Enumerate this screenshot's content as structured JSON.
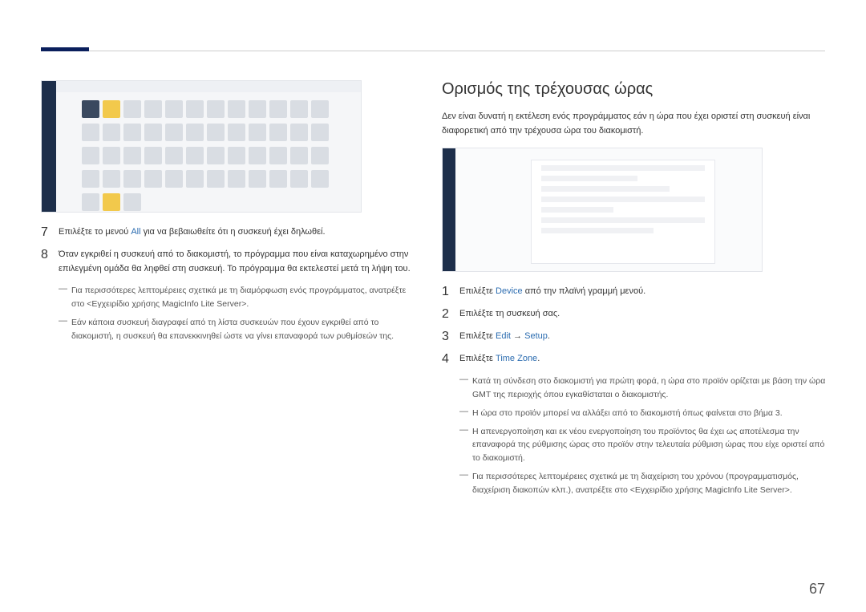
{
  "page_number": "67",
  "left": {
    "step7": {
      "num": "7",
      "prefix": "Επιλέξτε το μενού ",
      "link": "All",
      "suffix": " για να βεβαιωθείτε ότι η συσκευή έχει δηλωθεί."
    },
    "step8": {
      "num": "8",
      "text": "Όταν εγκριθεί η συσκευή από το διακομιστή, το πρόγραμμα που είναι καταχωρημένο στην επιλεγμένη ομάδα θα ληφθεί στη συσκευή. Το πρόγραμμα θα εκτελεστεί μετά τη λήψη του."
    },
    "note1": "Για περισσότερες λεπτομέρειες σχετικά με τη διαμόρφωση ενός προγράμματος, ανατρέξτε στο <Εγχειρίδιο χρήσης MagicInfo Lite Server>.",
    "note2": "Εάν κάποια συσκευή διαγραφεί από τη λίστα συσκευών που έχουν εγκριθεί από το διακομιστή, η συσκευή θα επανεκκινηθεί ώστε να γίνει επαναφορά των ρυθμίσεών της."
  },
  "right": {
    "title": "Ορισμός της τρέχουσας ώρας",
    "intro": "Δεν είναι δυνατή η εκτέλεση ενός προγράμματος εάν η ώρα που έχει οριστεί στη συσκευή είναι διαφορετική από την τρέχουσα ώρα του διακομιστή.",
    "step1": {
      "num": "1",
      "prefix": "Επιλέξτε ",
      "link": "Device",
      "suffix": " από την πλαϊνή γραμμή μενού."
    },
    "step2": {
      "num": "2",
      "text": "Επιλέξτε τη συσκευή σας."
    },
    "step3": {
      "num": "3",
      "prefix": "Επιλέξτε ",
      "link1": "Edit",
      "arrow": " → ",
      "link2": "Setup",
      "suffix": "."
    },
    "step4": {
      "num": "4",
      "prefix": "Επιλέξτε ",
      "link": "Time Zone",
      "suffix": "."
    },
    "note1": "Κατά τη σύνδεση στο διακομιστή για πρώτη φορά, η ώρα στο προϊόν ορίζεται με βάση την ώρα GMT της περιοχής όπου εγκαθίσταται ο διακομιστής.",
    "note2": "Η ώρα στο προϊόν μπορεί να αλλάξει από το διακομιστή όπως φαίνεται στο βήμα 3.",
    "note3": "Η απενεργοποίηση και εκ νέου ενεργοποίηση του προϊόντος θα έχει ως αποτέλεσμα την επαναφορά της ρύθμισης ώρας στο προϊόν στην τελευταία ρύθμιση ώρας που είχε οριστεί από το διακομιστή.",
    "note4": "Για περισσότερες λεπτομέρειες σχετικά με τη διαχείριση του χρόνου (προγραμματισμός, διαχείριση διακοπών κλπ.), ανατρέξτε στο <Εγχειρίδιο χρήσης MagicInfo Lite Server>."
  }
}
